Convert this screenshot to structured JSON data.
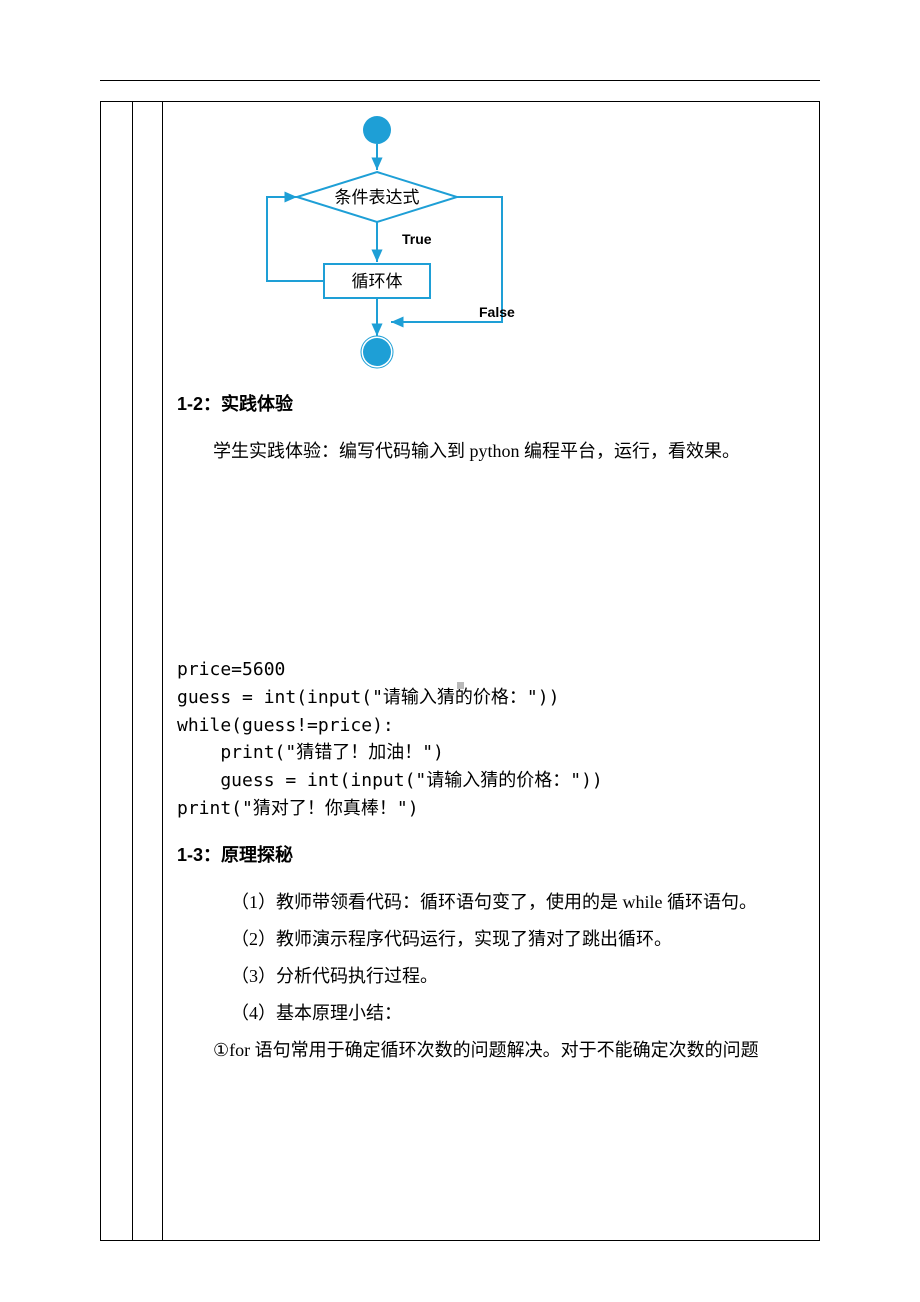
{
  "flowchart": {
    "decision": "条件表达式",
    "true_label": "True",
    "false_label": "False",
    "loop_body": "循环体",
    "theme": "#1E9FD6"
  },
  "sections": {
    "s12_title": "1-2：实践体验",
    "s12_body": "学生实践体验：编写代码输入到 python 编程平台，运行，看效果。",
    "s13_title": "1-3：原理探秘",
    "s13_items": {
      "i1": "（1）教师带领看代码：循环语句变了，使用的是 while 循环语句。",
      "i2": "（2）教师演示程序代码运行，实现了猜对了跳出循环。",
      "i3": "（3）分析代码执行过程。",
      "i4": "（4）基本原理小结：",
      "i5": "①for 语句常用于确定循环次数的问题解决。对于不能确定次数的问题"
    }
  },
  "code": {
    "l1": "price=5600",
    "l2": "guess = int(input(\"请输入猜的价格：\"))",
    "l3": "while(guess!=price):",
    "l4": "    print(\"猜错了！加油！\")",
    "l5": "    guess = int(input(\"请输入猜的价格：\"))",
    "l6": "print(\"猜对了！你真棒！\")"
  },
  "chart_data": {
    "type": "flowchart",
    "nodes": [
      {
        "id": "start",
        "kind": "terminator",
        "label": ""
      },
      {
        "id": "cond",
        "kind": "decision",
        "label": "条件表达式"
      },
      {
        "id": "body",
        "kind": "process",
        "label": "循环体"
      },
      {
        "id": "end",
        "kind": "terminator",
        "label": ""
      }
    ],
    "edges": [
      {
        "from": "start",
        "to": "cond",
        "label": ""
      },
      {
        "from": "cond",
        "to": "body",
        "label": "True"
      },
      {
        "from": "body",
        "to": "cond",
        "label": ""
      },
      {
        "from": "cond",
        "to": "end",
        "label": "False"
      }
    ]
  }
}
